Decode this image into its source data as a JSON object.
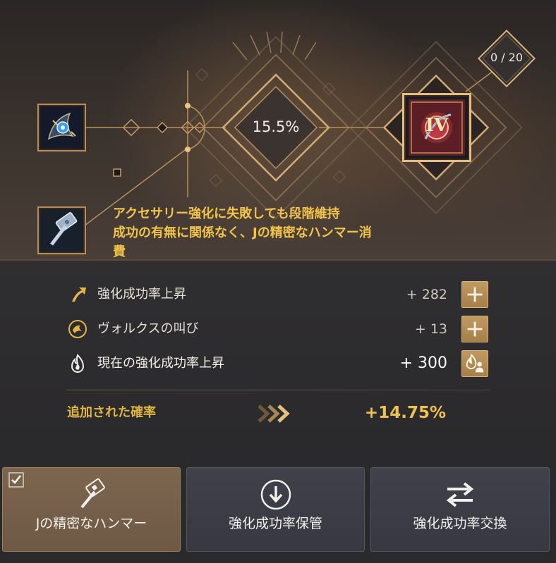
{
  "top_panel": {
    "rate_center": "15.5%",
    "counter": "0 / 20",
    "grade_badge": "IV",
    "description_lines": [
      "アクセサリー強化に失敗しても段階維持",
      "成功の有無に関係なく、Jの精密なハンマー消",
      "費"
    ]
  },
  "rows": [
    {
      "label": "強化成功率上昇",
      "value": "+ 282",
      "icon": "arrow-up-icon",
      "button_icon": "plus-icon"
    },
    {
      "label": "ヴォルクスの叫び",
      "value": "+ 13",
      "icon": "vorcus-emblem-icon",
      "button_icon": "plus-icon"
    },
    {
      "label": "現在の強化成功率上昇",
      "value": "+ 300",
      "icon": "flame-icon",
      "button_icon": "flame-people-icon"
    }
  ],
  "added": {
    "label": "追加された確率",
    "value": "+14.75%"
  },
  "buttons": [
    {
      "label": "Jの精密なハンマー",
      "icon": "hammer-icon",
      "checked": true
    },
    {
      "label": "強化成功率保管",
      "icon": "download-circle-icon",
      "checked": false
    },
    {
      "label": "強化成功率交換",
      "icon": "swap-arrows-icon",
      "checked": false
    }
  ],
  "colors": {
    "accent_gold": "#f2c44a",
    "button_active": "#7d6650",
    "button_normal": "#40414b",
    "plus_button": "#c09a62"
  }
}
